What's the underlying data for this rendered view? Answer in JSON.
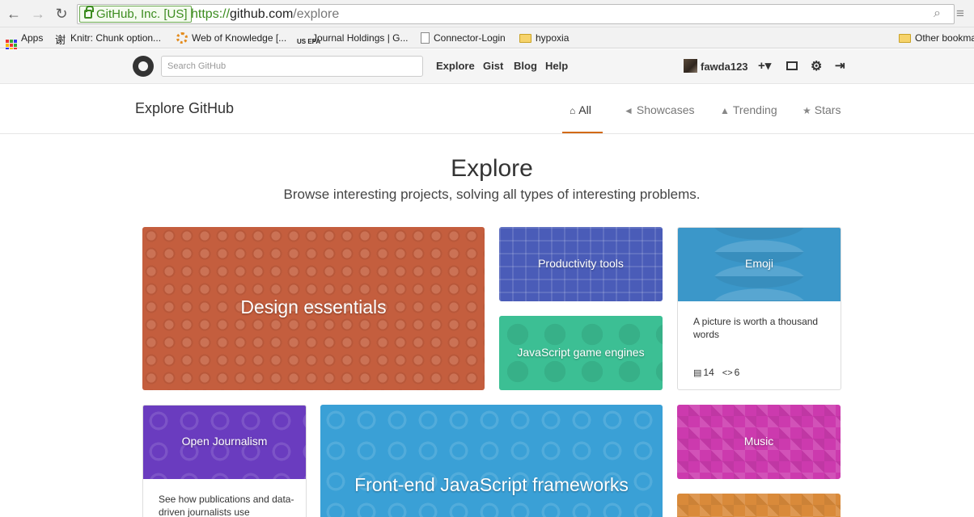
{
  "browser": {
    "ev_label": "GitHub, Inc. [US]",
    "url_scheme": "https://",
    "url_host": "github.com",
    "url_path": "/explore",
    "bookmarks": [
      {
        "label": "Apps"
      },
      {
        "label": "Knitr: Chunk option..."
      },
      {
        "label": "Web of Knowledge [..."
      },
      {
        "label": "Journal Holdings | G..."
      },
      {
        "label": "Connector-Login"
      },
      {
        "label": "hypoxia"
      }
    ],
    "other_bookmarks": "Other bookmarks",
    "epa_badge": "US EPA",
    "kanji_glyph": "谢"
  },
  "header": {
    "search_placeholder": "Search GitHub",
    "nav": [
      "Explore",
      "Gist",
      "Blog",
      "Help"
    ],
    "username": "fawda123",
    "plus_glyph": "+▾"
  },
  "subnav": {
    "title": "Explore GitHub",
    "tabs": [
      {
        "label": "All",
        "icon": "home-icon",
        "active": true
      },
      {
        "label": "Showcases",
        "icon": "megaphone-icon"
      },
      {
        "label": "Trending",
        "icon": "flame-icon"
      },
      {
        "label": "Stars",
        "icon": "star-icon"
      }
    ]
  },
  "hero": {
    "title": "Explore",
    "subtitle": "Browse interesting projects, solving all types of interesting problems."
  },
  "showcases": [
    {
      "label": "Design essentials",
      "color": "#c45e3e"
    },
    {
      "label": "Productivity tools",
      "color": "#4a5cb8"
    },
    {
      "label": "JavaScript game engines",
      "color": "#3cbf94"
    },
    {
      "label": "Emoji",
      "color": "#3b97c9",
      "description": "A picture is worth a thousand words",
      "repos": "14",
      "languages": "6"
    },
    {
      "label": "Open Journalism",
      "color": "#6a3cbf",
      "description": "See how publications and data-driven journalists use"
    },
    {
      "label": "Front-end JavaScript frameworks",
      "color": "#3aa0d6"
    },
    {
      "label": "Music",
      "color": "#cc3aae"
    },
    {
      "label": "",
      "color": "#d98a3a"
    }
  ]
}
